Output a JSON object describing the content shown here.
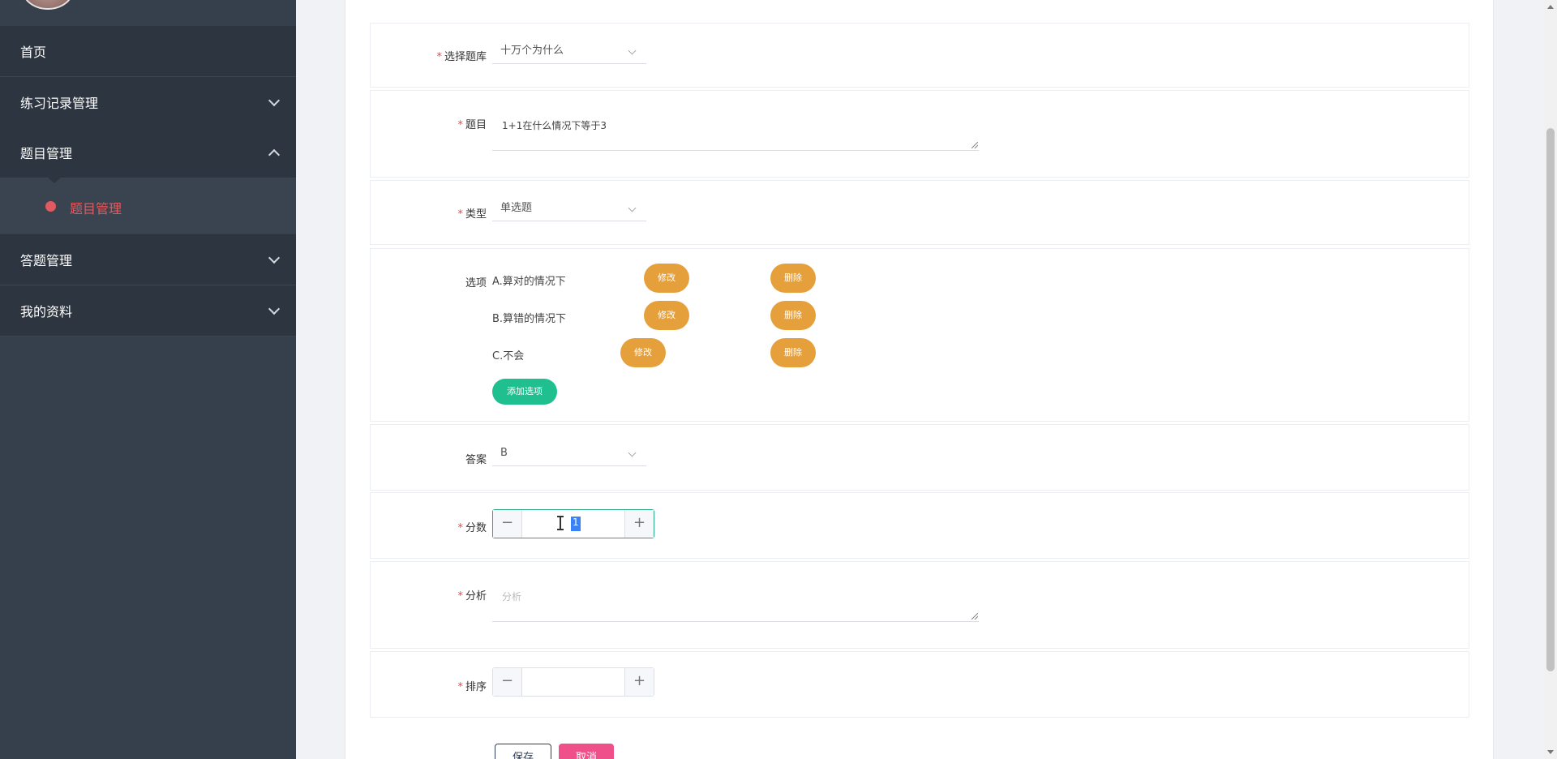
{
  "sidebar": {
    "items": [
      {
        "label": "首页"
      },
      {
        "label": "练习记录管理"
      },
      {
        "label": "题目管理"
      },
      {
        "label": "答题管理"
      },
      {
        "label": "我的资料"
      }
    ],
    "submenu": {
      "label": "题目管理"
    }
  },
  "form": {
    "bank": {
      "label": "选择题库",
      "value": "十万个为什么"
    },
    "question": {
      "label": "题目",
      "value": "1+1在什么情况下等于3"
    },
    "type": {
      "label": "类型",
      "value": "单选题"
    },
    "options": {
      "label": "选项",
      "items": [
        {
          "text": "A.算对的情况下",
          "edit": "修改",
          "delete": "删除"
        },
        {
          "text": "B.算错的情况下",
          "edit": "修改",
          "delete": "删除"
        },
        {
          "text": "C.不会",
          "edit": "修改",
          "delete": "删除"
        }
      ],
      "add_label": "添加选项"
    },
    "answer": {
      "label": "答案",
      "value": "B"
    },
    "score": {
      "label": "分数",
      "value": "1",
      "minus": "−",
      "plus": "+"
    },
    "analysis": {
      "label": "分析",
      "placeholder": "分析"
    },
    "sort": {
      "label": "排序",
      "value": "",
      "minus": "−",
      "plus": "+"
    },
    "required_mark": "*",
    "save_label": "保存",
    "cancel_label": "取消"
  },
  "colors": {
    "sidebar_bg": "#36404c",
    "active": "#e05a5f",
    "option_button": "#e5a03c",
    "add_button": "#1fbf8f",
    "cancel_button": "#f0508a"
  }
}
